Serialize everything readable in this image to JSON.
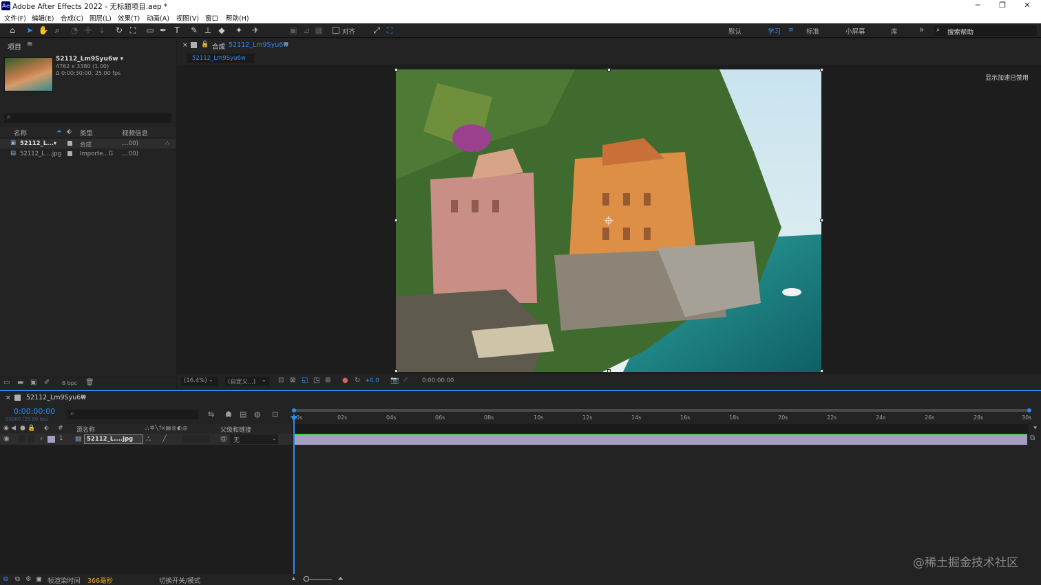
{
  "window": {
    "title": "Adobe After Effects 2022 - 无标题项目.aep *",
    "logo": "Ae",
    "minimize": "─",
    "maximize": "❐",
    "close": "✕"
  },
  "menu": [
    "文件(F)",
    "编辑(E)",
    "合成(C)",
    "图层(L)",
    "效果(T)",
    "动画(A)",
    "视图(V)",
    "窗口",
    "帮助(H)"
  ],
  "toolbar": {
    "snap_label": "对齐",
    "workspaces": [
      "默认",
      "学习",
      "标准",
      "小屏幕",
      "库"
    ],
    "more": "»",
    "help_search_placeholder": "搜索帮助"
  },
  "project": {
    "tab_label": "项目",
    "item_name": "52112_Lm9Syu6w ▾",
    "item_dims": "4762 x 3380 (1.00)",
    "item_duration": "Δ 0:00:30:00, 25.00 fps",
    "columns": [
      "名称",
      "类型",
      "视频信息"
    ],
    "rows": [
      {
        "name": "52112_L...▾",
        "type": "合成",
        "info": "....00)"
      },
      {
        "name": "52112_L....jpg",
        "type": "Importe...G",
        "info": "....00)"
      }
    ],
    "bpc": "8 bpc"
  },
  "comp": {
    "tab_prefix": "合成",
    "tab_name": "52112_Lm9Syu6w",
    "subtab": "52112_Lm9Syu6w",
    "accel_note": "显示加速已禁用",
    "zoom": "(16.4%)",
    "resolution": "(自定义...)",
    "exposure": "+0.0",
    "timecode": "0:00:00:00"
  },
  "timeline": {
    "tab_name": "52112_Lm9Syu6w",
    "timecode": "0:00:00:00",
    "frame_info": "00000 (25.00 fps)",
    "col_source": "源名称",
    "col_parent": "父级和链接",
    "layer_num": "1",
    "layer_name": "52112_L....jpg",
    "parent_value": "无",
    "ticks": [
      "0s",
      "02s",
      "04s",
      "06s",
      "08s",
      "10s",
      "12s",
      "14s",
      "16s",
      "18s",
      "20s",
      "22s",
      "24s",
      "26s",
      "28s",
      "30s"
    ]
  },
  "status": {
    "render_label": "帧渲染时间",
    "render_value": "366毫秒",
    "toggle": "切换开关/模式"
  },
  "watermark": "@稀土掘金技术社区",
  "colors": {
    "accent": "#2d8ceb",
    "orange": "#e8a23a",
    "layer_bar": "#a59ec0"
  }
}
